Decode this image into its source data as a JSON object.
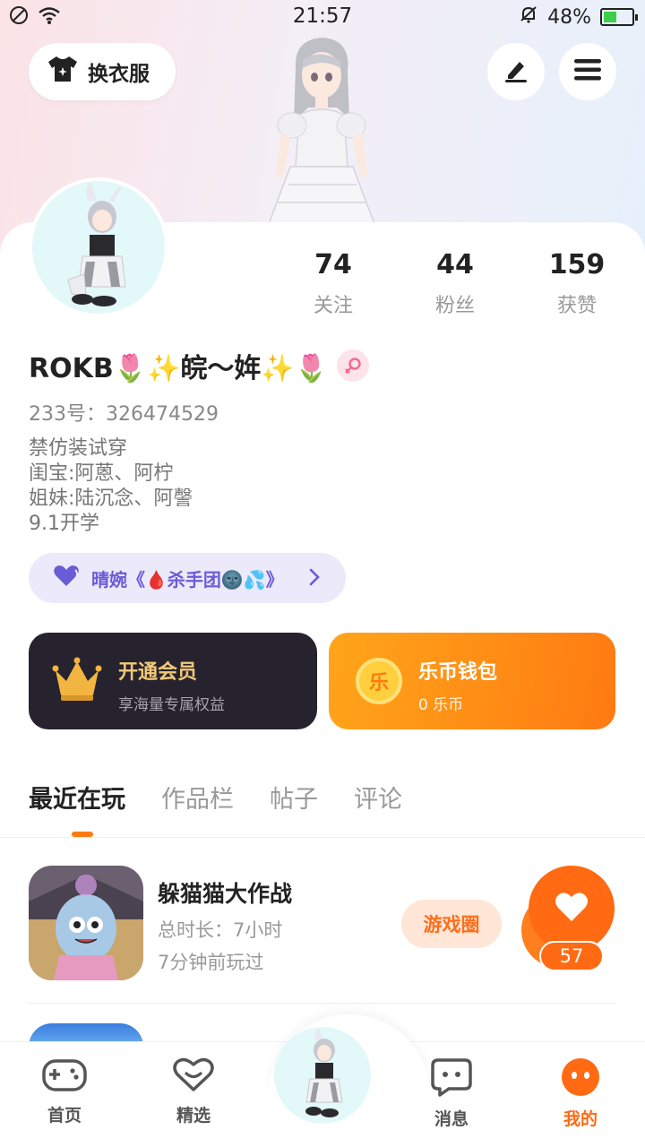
{
  "status_bar": {
    "time": "21:57",
    "battery": "48%",
    "battery_level": 0.48
  },
  "header": {
    "outfit_label": "换衣服"
  },
  "stats": [
    {
      "num": "74",
      "label": "关注"
    },
    {
      "num": "44",
      "label": "粉丝"
    },
    {
      "num": "159",
      "label": "获赞"
    }
  ],
  "profile": {
    "nickname": "ROKB🌷✨皖～姩✨🌷",
    "uid": "233号：326474529",
    "bio": [
      "禁仿装试穿",
      "闺宝:阿蒽、阿柠",
      "姐妹:陆沉念、阿謦",
      "9.1开学"
    ],
    "group": "晴婉《🩸杀手团🌚💦》"
  },
  "cards": {
    "vip_title": "开通会员",
    "vip_sub": "享海量专属权益",
    "wallet_title": "乐币钱包",
    "wallet_sub": "0 乐币",
    "coin_glyph": "乐"
  },
  "tabs": [
    "最近在玩",
    "作品栏",
    "帖子",
    "评论"
  ],
  "game": {
    "name": "躲猫猫大作战",
    "duration": "总时长：7小时",
    "last_played": "7分钟前玩过",
    "circle_label": "游戏圈"
  },
  "like": {
    "count": "57"
  },
  "nav": {
    "home": "首页",
    "featured": "精选",
    "messages": "消息",
    "me": "我的"
  },
  "colors": {
    "accent": "#ff6a12",
    "vip_bg": "#26232f",
    "vip_gold": "#f2c978",
    "group_text": "#6a5bd6"
  }
}
